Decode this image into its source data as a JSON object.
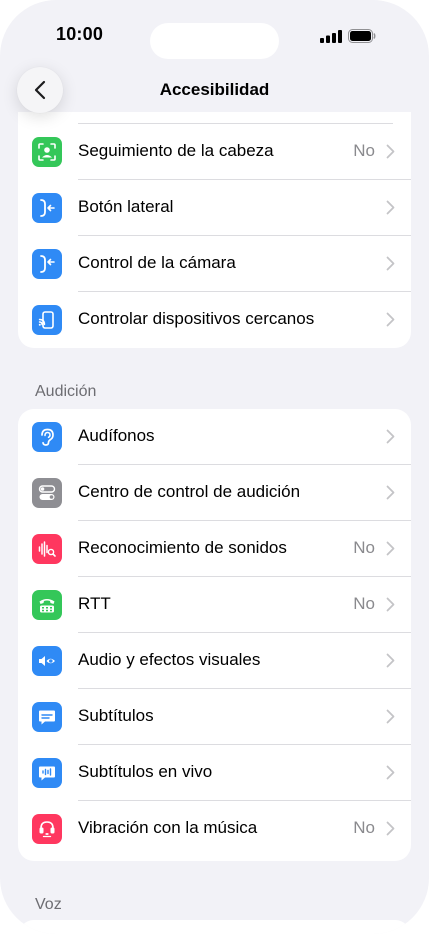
{
  "status_bar": {
    "time": "10:00"
  },
  "nav": {
    "title": "Accesibilidad"
  },
  "colors": {
    "background": "#f2f2f7",
    "card": "#ffffff",
    "green": "#34c759",
    "blue": "#2f8af5",
    "gray": "#8e8e93",
    "pink": "#ff375f",
    "secondary_text": "#8a8a8e"
  },
  "sections": {
    "physical": {
      "items": [
        {
          "label": "Seguimiento de la cabeza",
          "value": "No",
          "icon": "head-tracking-icon"
        },
        {
          "label": "Botón lateral",
          "value": "",
          "icon": "side-button-icon"
        },
        {
          "label": "Control de la cámara",
          "value": "",
          "icon": "camera-control-icon"
        },
        {
          "label": "Controlar dispositivos cercanos",
          "value": "",
          "icon": "nearby-devices-icon"
        }
      ]
    },
    "hearing": {
      "header": "Audición",
      "items": [
        {
          "label": "Audífonos",
          "value": "",
          "icon": "ear-icon"
        },
        {
          "label": "Centro de control de audición",
          "value": "",
          "icon": "toggles-icon"
        },
        {
          "label": "Reconocimiento de sonidos",
          "value": "No",
          "icon": "sound-recognition-icon"
        },
        {
          "label": "RTT",
          "value": "No",
          "icon": "tty-phone-icon"
        },
        {
          "label": "Audio y efectos visuales",
          "value": "",
          "icon": "audio-visual-icon"
        },
        {
          "label": "Subtítulos",
          "value": "",
          "icon": "subtitles-icon"
        },
        {
          "label": "Subtítulos en vivo",
          "value": "",
          "icon": "live-captions-icon"
        },
        {
          "label": "Vibración con la música",
          "value": "No",
          "icon": "music-haptics-icon"
        }
      ]
    },
    "voice": {
      "header": "Voz"
    }
  }
}
